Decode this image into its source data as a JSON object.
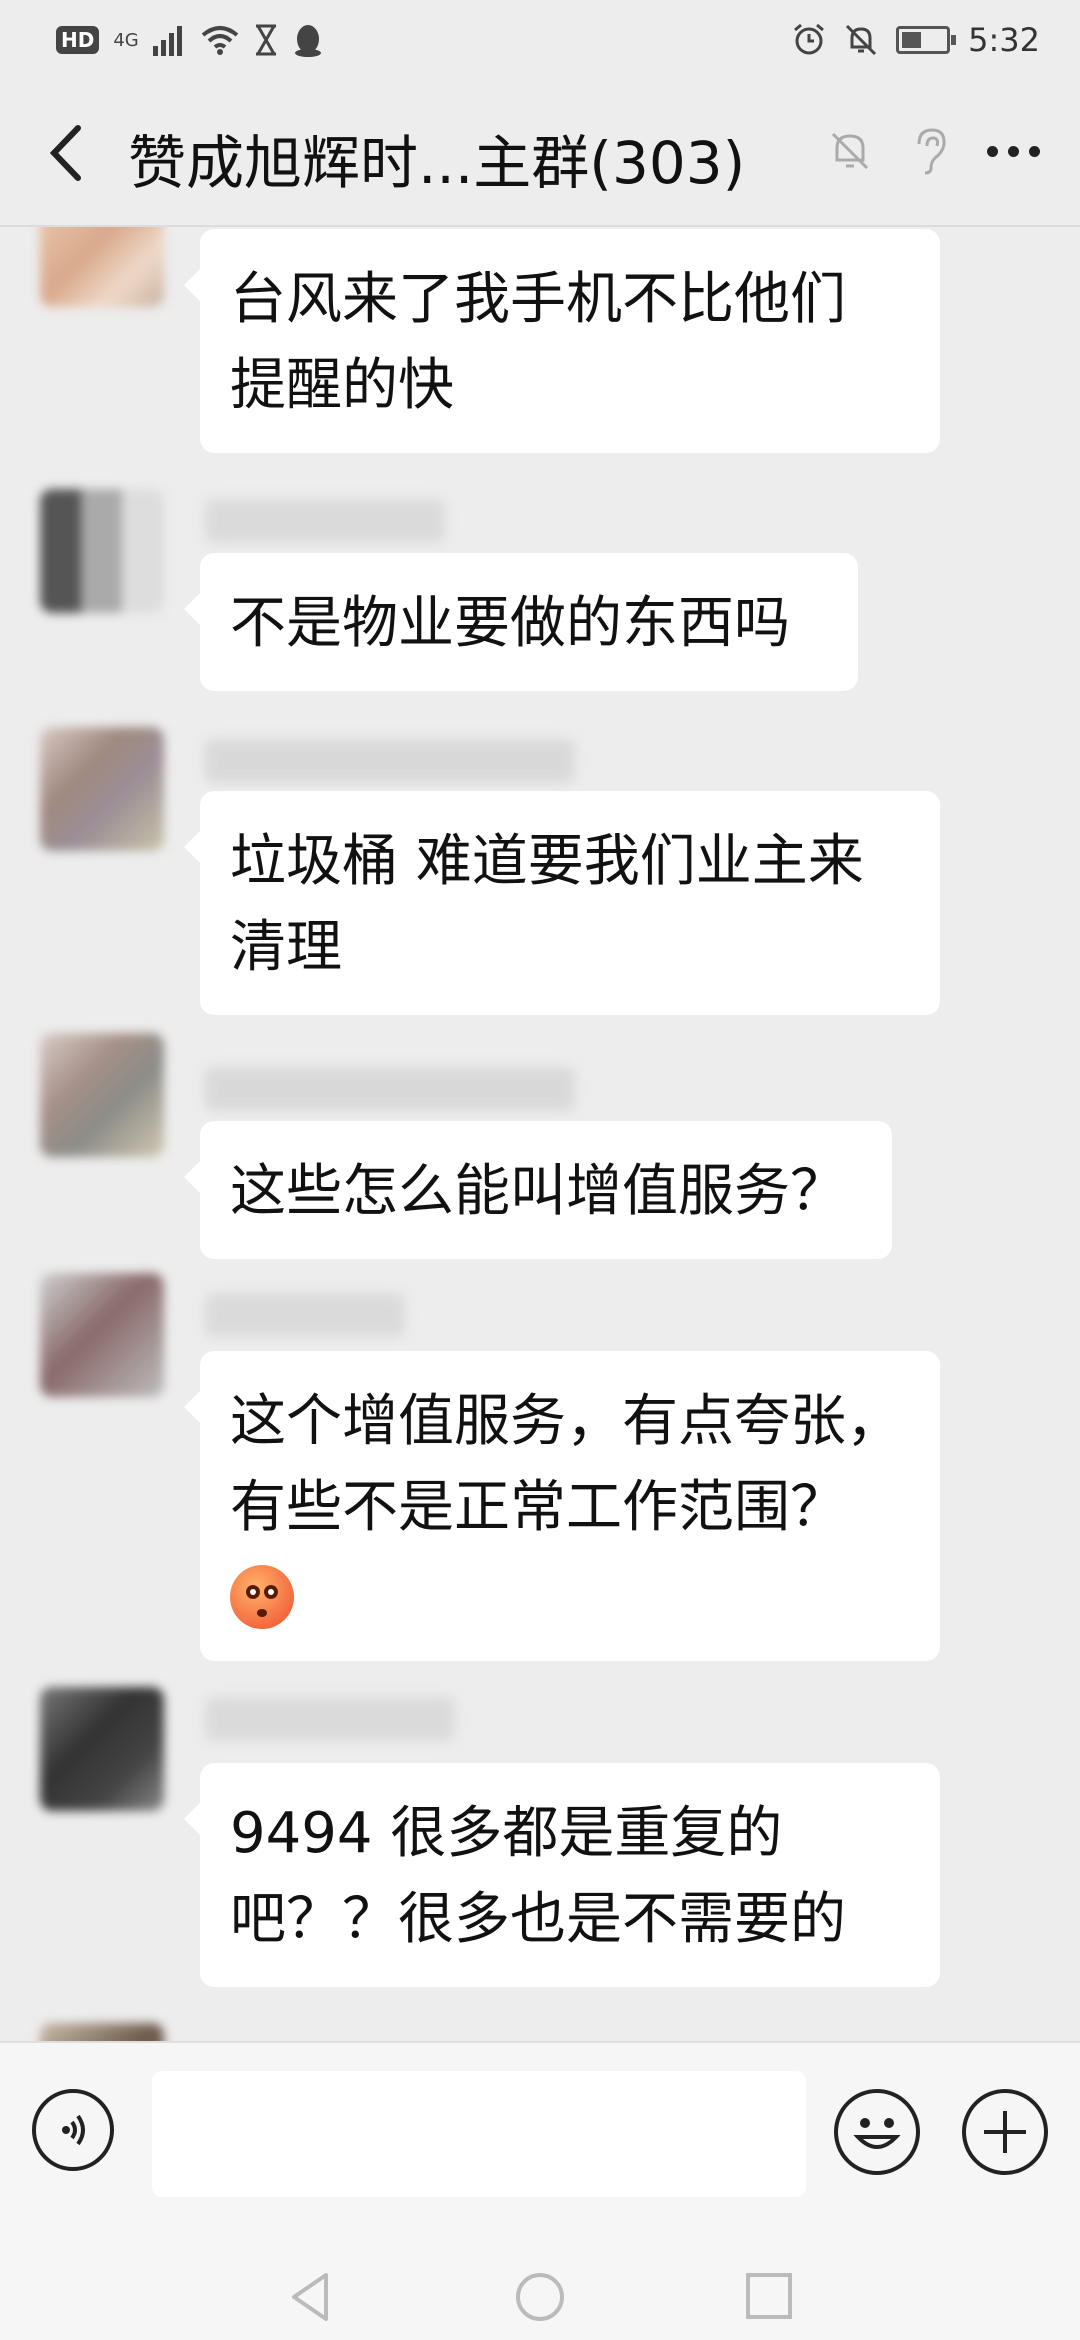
{
  "status_bar": {
    "network_badge": "HD",
    "network_type": "4G",
    "time": "5:32",
    "icons": [
      "wifi-icon",
      "hourglass-icon",
      "penguin-icon",
      "alarm-icon",
      "mute-icon",
      "battery-icon"
    ]
  },
  "header": {
    "title": "赞成旭辉时...主群(303)",
    "icons": [
      "back-icon",
      "mute-bell-icon",
      "ear-icon",
      "more-icon"
    ]
  },
  "messages": [
    {
      "lines": [
        "台风来了我手机不比他们",
        "提醒的快"
      ]
    },
    {
      "lines": [
        "不是物业要做的东西吗"
      ]
    },
    {
      "lines": [
        "垃圾桶 难道要我们业主来",
        "清理"
      ]
    },
    {
      "lines": [
        "这些怎么能叫增值服务？"
      ]
    },
    {
      "lines": [
        "这个增值服务，有点夸张，",
        "有些不是正常工作范围？"
      ],
      "emoji": "flushed-face-emoji"
    },
    {
      "lines": [
        "9494 很多都是重复的",
        "吧？？很多也是不需要的"
      ]
    }
  ],
  "input_bar": {
    "text_value": "",
    "icons": [
      "voice-icon",
      "emoji-icon",
      "plus-icon"
    ]
  },
  "nav_bar": {
    "icons": [
      "nav-back-icon",
      "nav-home-icon",
      "nav-recents-icon"
    ]
  }
}
